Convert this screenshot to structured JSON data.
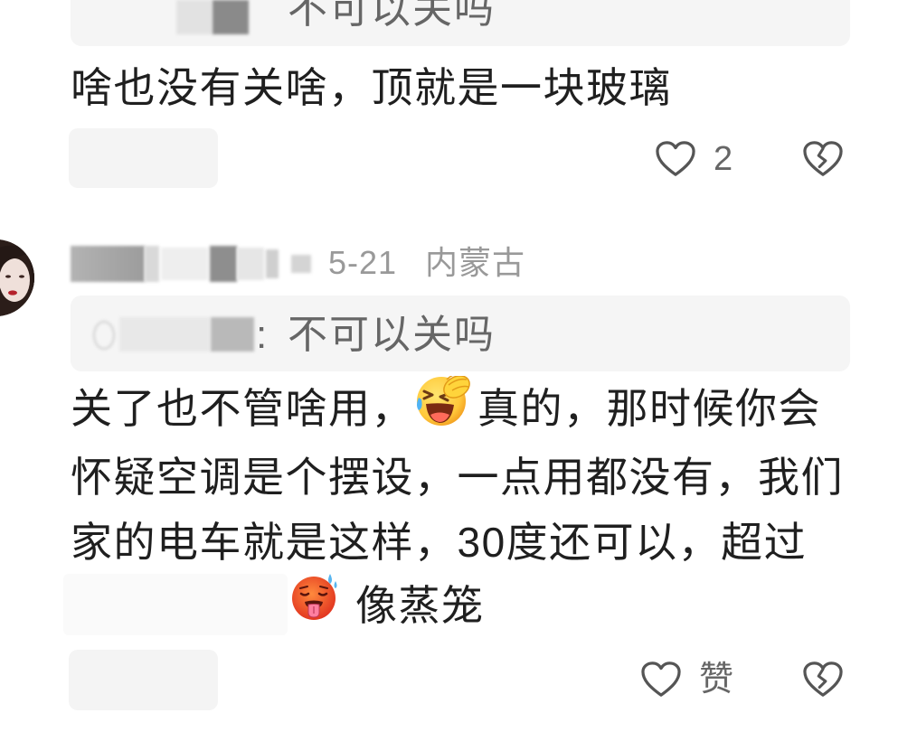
{
  "colors": {
    "text": "#1f1f1f",
    "muted": "#999999",
    "quote_text": "#666666",
    "quote_bg": "#f5f5f5",
    "icon": "#555555",
    "redaction": "#f4f4f4"
  },
  "comments": [
    {
      "quote": {
        "text": "不可以关吗"
      },
      "body": "啥也没有关啥，顶就是一块玻璃",
      "like": {
        "icon": "heart-outline-icon",
        "count": "2"
      },
      "dislike": {
        "icon": "broken-heart-icon"
      }
    },
    {
      "date": "5-21",
      "location": "内蒙古",
      "quote": {
        "separator": ":",
        "text": "不可以关吗"
      },
      "body": {
        "line1_a": "关了也不管啥用，",
        "emoji_1": "facepalm-laugh-emoji",
        "line1_b": "真的，那时候你会",
        "line2": "怀疑空调是个摆设，一点用都没有，我们",
        "line3": "家的电车就是这样，30度还可以，超过",
        "emoji_2": "hot-face-emoji",
        "line4": "像蒸笼"
      },
      "like": {
        "icon": "heart-outline-icon",
        "label": "赞"
      },
      "dislike": {
        "icon": "broken-heart-icon"
      }
    }
  ]
}
